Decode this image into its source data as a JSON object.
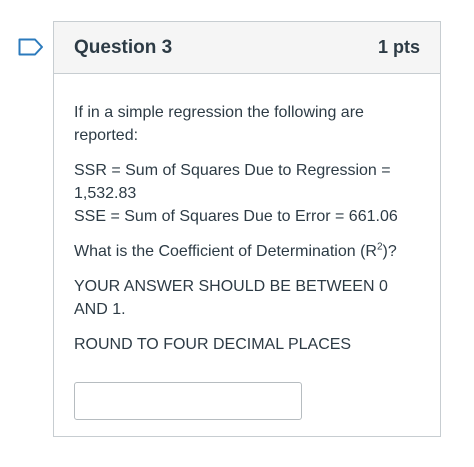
{
  "question": {
    "title": "Question 3",
    "points": "1 pts",
    "intro": "If in a simple regression the following are reported:",
    "ssr_line1": "SSR = Sum of Squares Due to Regression =",
    "ssr_line2": "1,532.83",
    "sse_line": "SSE = Sum of Squares Due to Error = 661.06",
    "prompt_before": "What is the Coefficient of Determination (R",
    "prompt_sup": "2",
    "prompt_after": ")?",
    "range_note": "YOUR ANSWER SHOULD BE BETWEEN 0 AND 1.",
    "round_note": "ROUND TO FOUR DECIMAL PLACES",
    "answer_value": ""
  },
  "icons": {
    "flag": "bookmark-flag-icon"
  },
  "colors": {
    "flag_stroke": "#2b7abc",
    "header_bg": "#f5f5f5",
    "border": "#c7cdd1",
    "text": "#2d3b45"
  }
}
